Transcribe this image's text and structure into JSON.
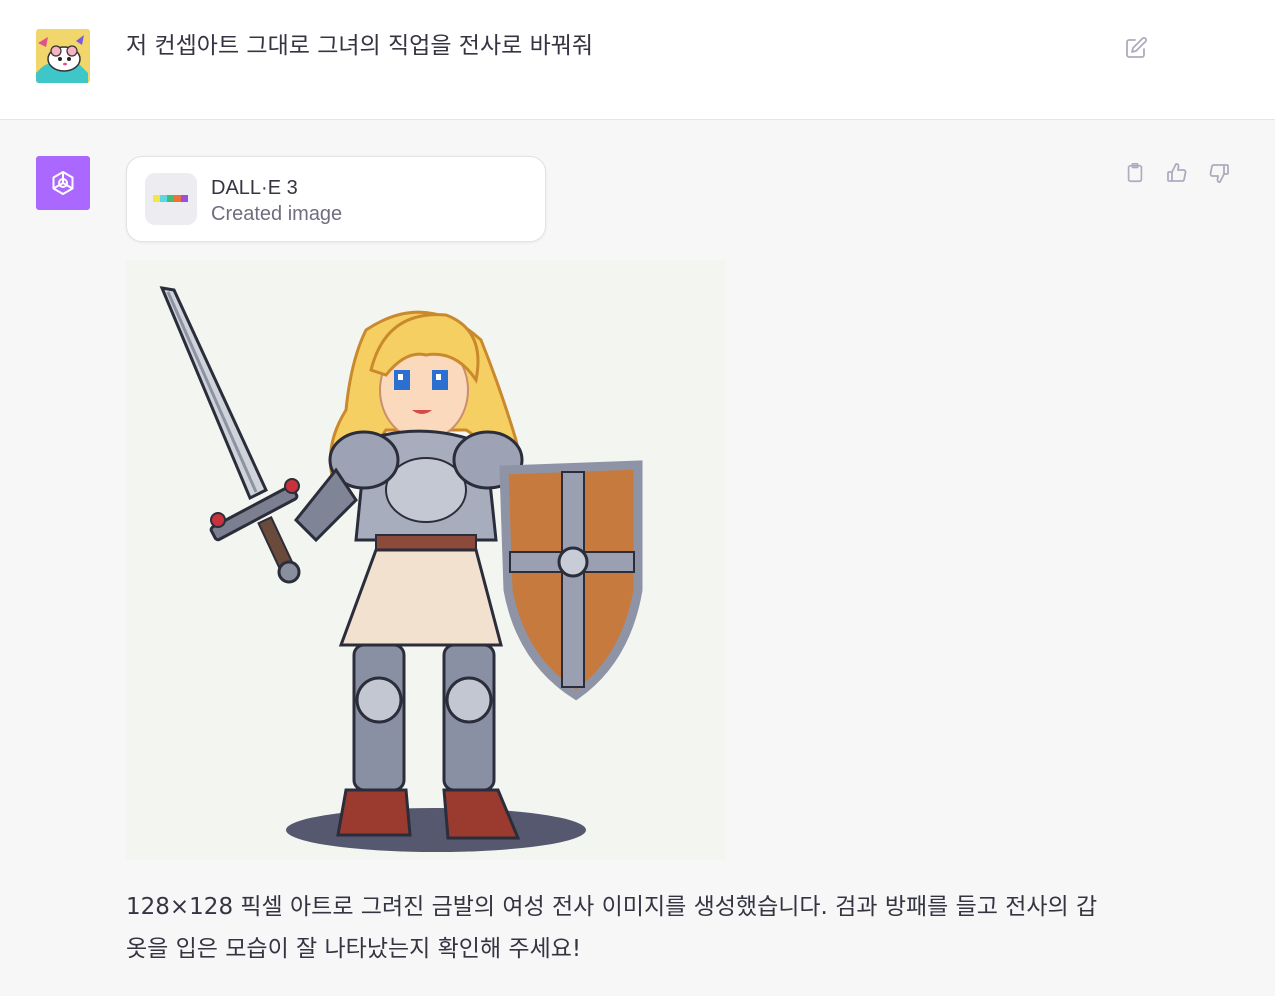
{
  "user_message": {
    "text": "저 컨셉아트 그대로 그녀의 직업을 전사로 바꿔줘",
    "avatar_icon": "hamster-avatar-icon",
    "edit_icon": "edit-icon"
  },
  "assistant": {
    "avatar_icon": "openai-logo-icon",
    "accent": "#ab68ff",
    "tool": {
      "name": "DALL·E 3",
      "status": "Created image",
      "thumb_colors": [
        "#f5e642",
        "#5bd7e6",
        "#3fbf6f",
        "#f0703a",
        "#9b4fe0"
      ]
    },
    "image": {
      "alt": "Pixel art of a blonde female warrior in silver armor holding a sword and a wooden shield"
    },
    "reply": "128×128 픽셀 아트로 그려진 금발의 여성 전사 이미지를 생성했습니다. 검과 방패를 들고 전사의 갑옷을 입은 모습이 잘 나타났는지 확인해 주세요!",
    "actions": [
      {
        "name": "copy",
        "icon": "clipboard-icon"
      },
      {
        "name": "thumbs-up",
        "icon": "thumbs-up-icon"
      },
      {
        "name": "thumbs-down",
        "icon": "thumbs-down-icon"
      }
    ]
  }
}
